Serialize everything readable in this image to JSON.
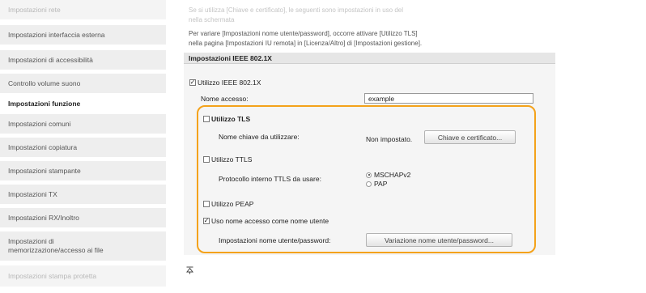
{
  "sidebar": {
    "items": [
      {
        "label": "Impostazioni rete",
        "faded": true
      },
      {
        "label": "Impostazioni interfaccia esterna"
      },
      {
        "label": "Impostazioni di accessibilità"
      },
      {
        "label": "Controllo volume suono"
      }
    ],
    "section_title": "Impostazioni funzione",
    "function_items": [
      {
        "label": "Impostazioni comuni"
      },
      {
        "label": "Impostazioni copiatura"
      },
      {
        "label": "Impostazioni stampante"
      },
      {
        "label": "Impostazioni TX"
      },
      {
        "label": "Impostazioni RX/Inoltro"
      },
      {
        "label_line1": "Impostazioni di",
        "label_line2": "memorizzazione/accesso ai file"
      },
      {
        "label": "Impostazioni stampa protetta",
        "faded": true
      }
    ]
  },
  "notes": {
    "line1": "Se si utilizza [Chiave e certificato], le seguenti sono impostazioni in uso del",
    "line2": "nella schermata",
    "line3": "Per variare [Impostazioni nome utente/password], occorre attivare [Utilizzo TLS]",
    "line4": "nella pagina [Impostazioni IU remota] in [Licenza/Altro] di [Impostazioni gestione]."
  },
  "ieee": {
    "header": "Impostazioni IEEE 802.1X",
    "use_ieee_label": "Utilizzo IEEE 802.1X",
    "use_ieee_checked": true,
    "login_name_label": "Nome accesso:",
    "login_name_value": "example",
    "tls_label": "Utilizzo TLS",
    "tls_checked": false,
    "key_label": "Nome chiave da utilizzare:",
    "key_value": "Non impostato.",
    "key_button": "Chiave e certificato...",
    "ttls_label": "Utilizzo TTLS",
    "ttls_checked": false,
    "ttls_protocol_label": "Protocollo interno TTLS da usare:",
    "ttls_option1": "MSCHAPv2",
    "ttls_option2": "PAP",
    "peap_label": "Utilizzo PEAP",
    "peap_checked": false,
    "use_login_as_user_label": "Uso nome accesso come nome utente",
    "use_login_as_user_checked": true,
    "user_pw_label": "Impostazioni nome utente/password:",
    "user_pw_button": "Variazione nome utente/password..."
  },
  "colors": {
    "highlight": "#f4a21a"
  },
  "footer_icon": "scroll-top-icon"
}
